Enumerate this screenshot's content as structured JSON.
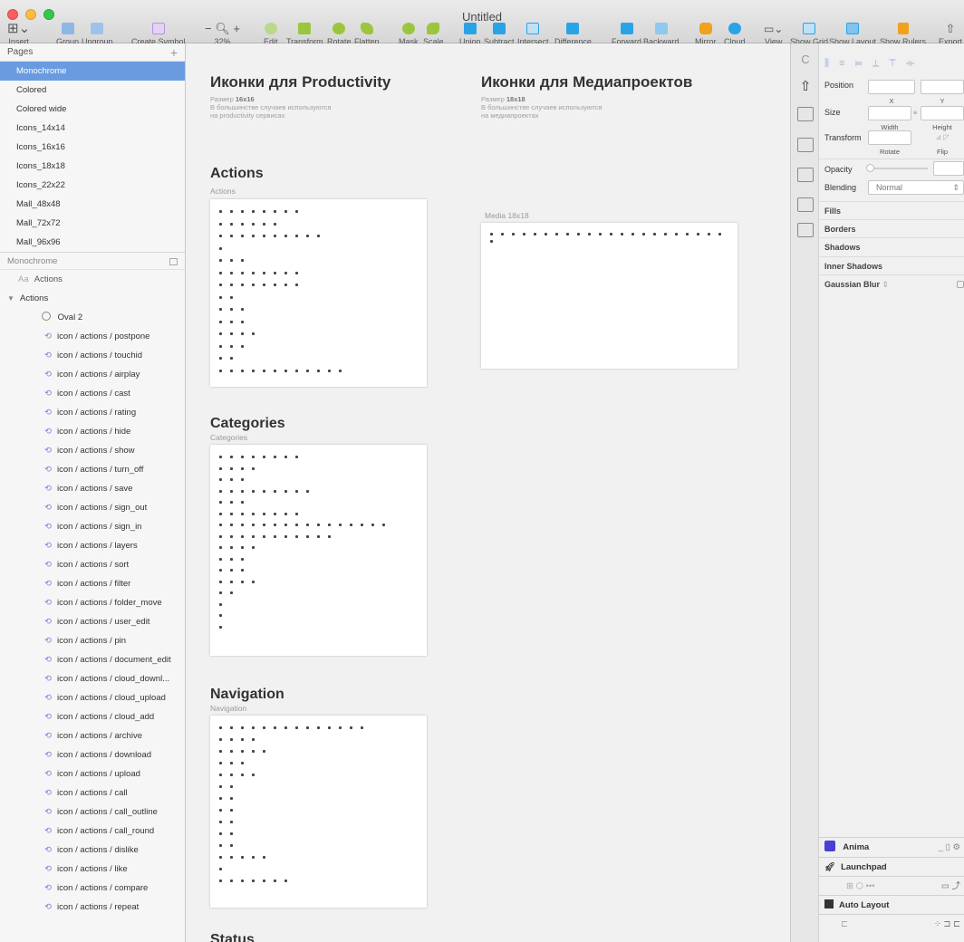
{
  "window": {
    "title": "Untitled"
  },
  "toolbar": {
    "insert": "Insert",
    "group": "Group",
    "ungroup": "Ungroup",
    "create_symbol": "Create Symbol",
    "zoom": "32%",
    "edit": "Edit",
    "transform": "Transform",
    "rotate": "Rotate",
    "flatten": "Flatten",
    "mask": "Mask",
    "scale": "Scale",
    "union": "Union",
    "subtract": "Subtract",
    "intersect": "Intersect",
    "difference": "Difference",
    "forward": "Forward",
    "backward": "Backward",
    "mirror": "Mirror",
    "cloud": "Cloud",
    "view": "View",
    "show_grid": "Show Grid",
    "show_layout": "Show Layout",
    "show_rulers": "Show Rulers",
    "export": "Export",
    "colors": {
      "accent_blue": "#2aa3e6",
      "green": "#9bc53d",
      "orange": "#f0a21a"
    }
  },
  "sidebar": {
    "pages_header": "Pages",
    "pages": [
      "Monochrome",
      "Colored",
      "Colored wide",
      "Icons_14x14",
      "Icons_16x16",
      "Icons_18x18",
      "Icons_22x22",
      "Mall_48x48",
      "Mall_72x72",
      "Mall_96x96"
    ],
    "selected_page": "Monochrome",
    "layers_header": "Monochrome",
    "text_layer": {
      "prefix": "Aa",
      "label": "Actions"
    },
    "group": "Actions",
    "oval": "Oval 2",
    "symbols": [
      "icon / actions / postpone",
      "icon / actions / touchid",
      "icon / actions / airplay",
      "icon / actions / cast",
      "icon / actions / rating",
      "icon / actions / hide",
      "icon / actions / show",
      "icon / actions / turn_off",
      "icon / actions / save",
      "icon / actions / sign_out",
      "icon / actions / sign_in",
      "icon / actions / layers",
      "icon / actions / sort",
      "icon / actions / filter",
      "icon / actions / folder_move",
      "icon / actions / user_edit",
      "icon / actions / pin",
      "icon / actions / document_edit",
      "icon / actions / cloud_downl...",
      "icon / actions / cloud_upload",
      "icon / actions / cloud_add",
      "icon / actions / archive",
      "icon / actions / download",
      "icon / actions / upload",
      "icon / actions / call",
      "icon / actions / call_outline",
      "icon / actions / call_round",
      "icon / actions / dislike",
      "icon / actions / like",
      "icon / actions / compare",
      "icon / actions / repeat"
    ]
  },
  "canvas": {
    "productivity": {
      "title": "Иконки для Productivity",
      "size_prefix": "Размер ",
      "size": "16x16",
      "desc1": "В большинстве случаев используются",
      "desc2": "на productivity сервисах"
    },
    "media": {
      "title": "Иконки для Медиапроектов",
      "size_prefix": "Размер ",
      "size": "18x18",
      "desc1": "В большинстве случаев используются",
      "desc2": "на медиапроектах",
      "frame_label": "Media 18x18"
    },
    "actions": {
      "title": "Actions",
      "label": "Actions"
    },
    "categories": {
      "title": "Categories",
      "label": "Categories"
    },
    "navigation": {
      "title": "Navigation",
      "label": "Navigation"
    },
    "status": {
      "title": "Status"
    }
  },
  "inspector": {
    "position": "Position",
    "x": "X",
    "y": "Y",
    "size": "Size",
    "width": "Width",
    "height": "Height",
    "transform": "Transform",
    "rotate": "Rotate",
    "flip": "Flip",
    "opacity": "Opacity",
    "blending": "Blending",
    "blending_value": "Normal",
    "fills": "Fills",
    "borders": "Borders",
    "shadows": "Shadows",
    "inner_shadows": "Inner Shadows",
    "gaussian_blur": "Gaussian Blur",
    "anima": "Anima",
    "launchpad": "Launchpad",
    "auto_layout": "Auto Layout",
    "colors": {
      "anima": "#4a3fd1",
      "selection": "#6a9be0"
    }
  }
}
